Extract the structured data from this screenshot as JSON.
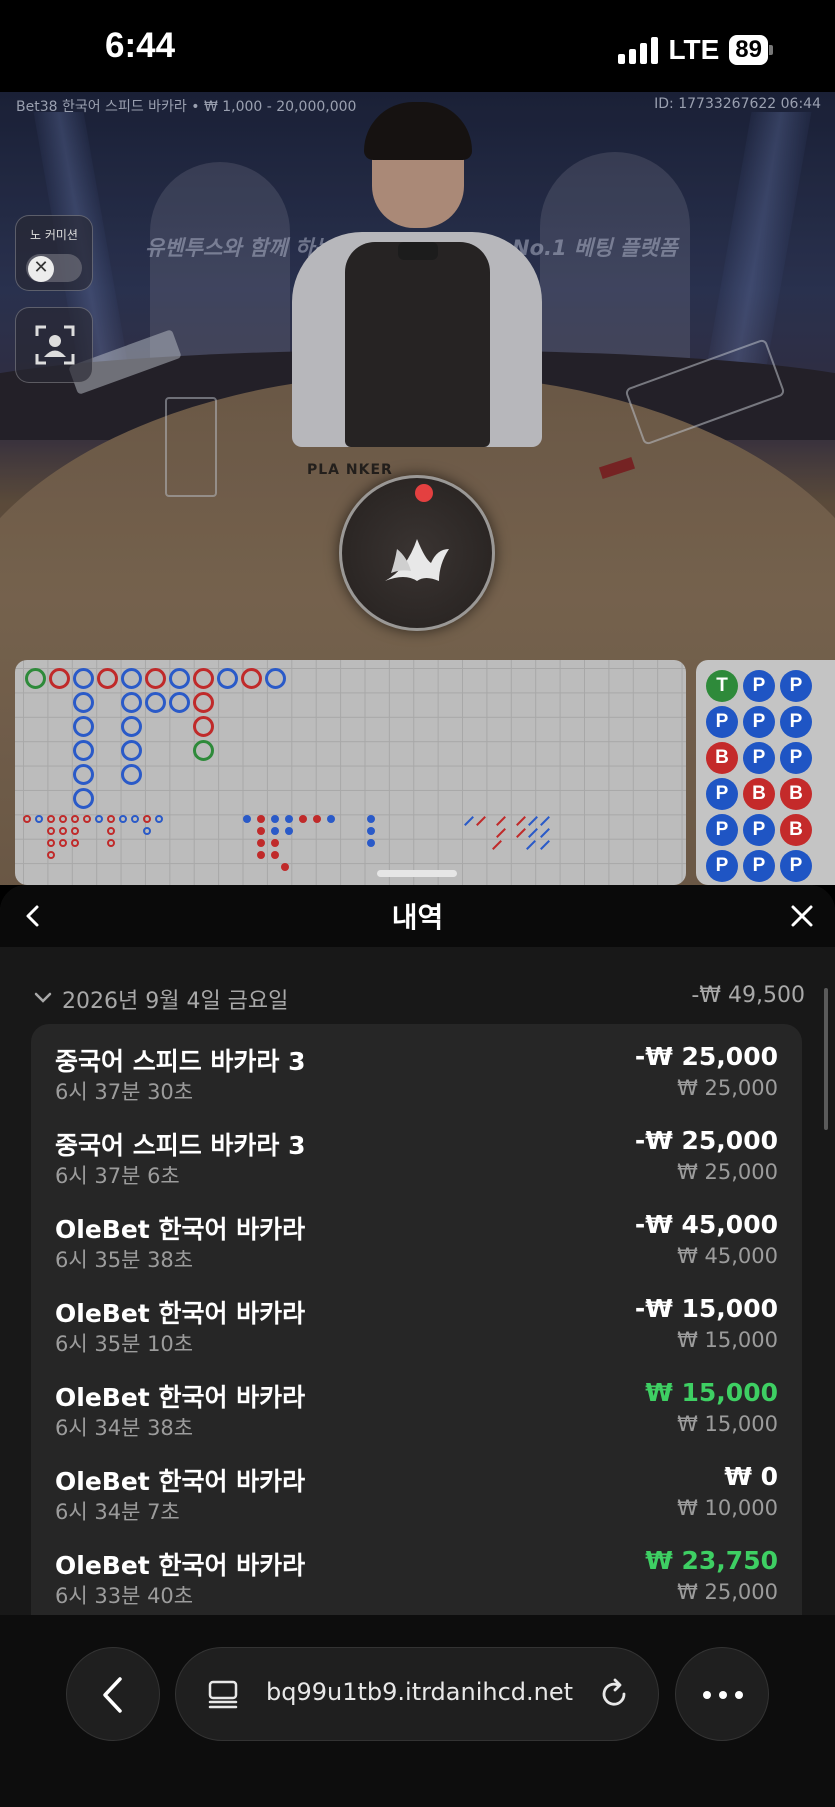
{
  "status_bar": {
    "time": "6:44",
    "network": "LTE",
    "battery": "89"
  },
  "game": {
    "info_left": "Bet38 한국어 스피드 바카라 • ₩ 1,000 - 20,000,000",
    "info_right": "ID: 17733267622 06:44",
    "banner_left": "유벤투스와 함께 하는",
    "banner_right": "No.1 베팅 플랫폼",
    "table_text": "PLA    NKER",
    "no_commission_label": "노 커미션",
    "no_commission_toggle": "✕"
  },
  "bead_road": {
    "columns": [
      [
        "P",
        "P",
        "P",
        "P",
        "P",
        "P"
      ],
      [
        "B"
      ],
      [
        "P",
        "P",
        "P",
        "P",
        "P"
      ],
      [
        "B"
      ],
      [
        "P",
        "P",
        "P",
        "P",
        "P"
      ]
    ],
    "rows": [
      [
        "T",
        "P",
        "P"
      ],
      [
        "P",
        "P",
        "P"
      ],
      [
        "B",
        "P",
        "P"
      ],
      [
        "P",
        "B",
        "B"
      ],
      [
        "P",
        "P",
        "B"
      ],
      [
        "P",
        "P",
        "P"
      ]
    ]
  },
  "history": {
    "title": "내역",
    "date": "2026년 9월 4일 금요일",
    "date_total": "-₩ 49,500",
    "items": [
      {
        "name": "중국어 스피드 바카라 3",
        "time": "6시 37분 30초",
        "result": "-₩ 25,000",
        "stake": "₩ 25,000",
        "win": false
      },
      {
        "name": "중국어 스피드 바카라 3",
        "time": "6시 37분 6초",
        "result": "-₩ 25,000",
        "stake": "₩ 25,000",
        "win": false
      },
      {
        "name": "OleBet 한국어 바카라",
        "time": "6시 35분 38초",
        "result": "-₩ 45,000",
        "stake": "₩ 45,000",
        "win": false
      },
      {
        "name": "OleBet 한국어 바카라",
        "time": "6시 35분 10초",
        "result": "-₩ 15,000",
        "stake": "₩ 15,000",
        "win": false
      },
      {
        "name": "OleBet 한국어 바카라",
        "time": "6시 34분 38초",
        "result": "₩ 15,000",
        "stake": "₩ 15,000",
        "win": true
      },
      {
        "name": "OleBet 한국어 바카라",
        "time": "6시 34분 7초",
        "result": "₩ 0",
        "stake": "₩ 10,000",
        "win": false
      },
      {
        "name": "OleBet 한국어 바카라",
        "time": "6시 33분 40초",
        "result": "₩ 23,750",
        "stake": "₩ 25,000",
        "win": true
      }
    ]
  },
  "browser": {
    "url": "bq99u1tb9.itrdanihcd.net"
  },
  "colors": {
    "win": "#3ecf63",
    "banker": "#c42a2a",
    "player": "#1f55c4",
    "tie": "#2e8a3a"
  },
  "icons": [
    "back-icon",
    "close-icon",
    "chevron-down-icon",
    "camera-icon",
    "tabs-icon",
    "reload-icon",
    "more-icon"
  ]
}
